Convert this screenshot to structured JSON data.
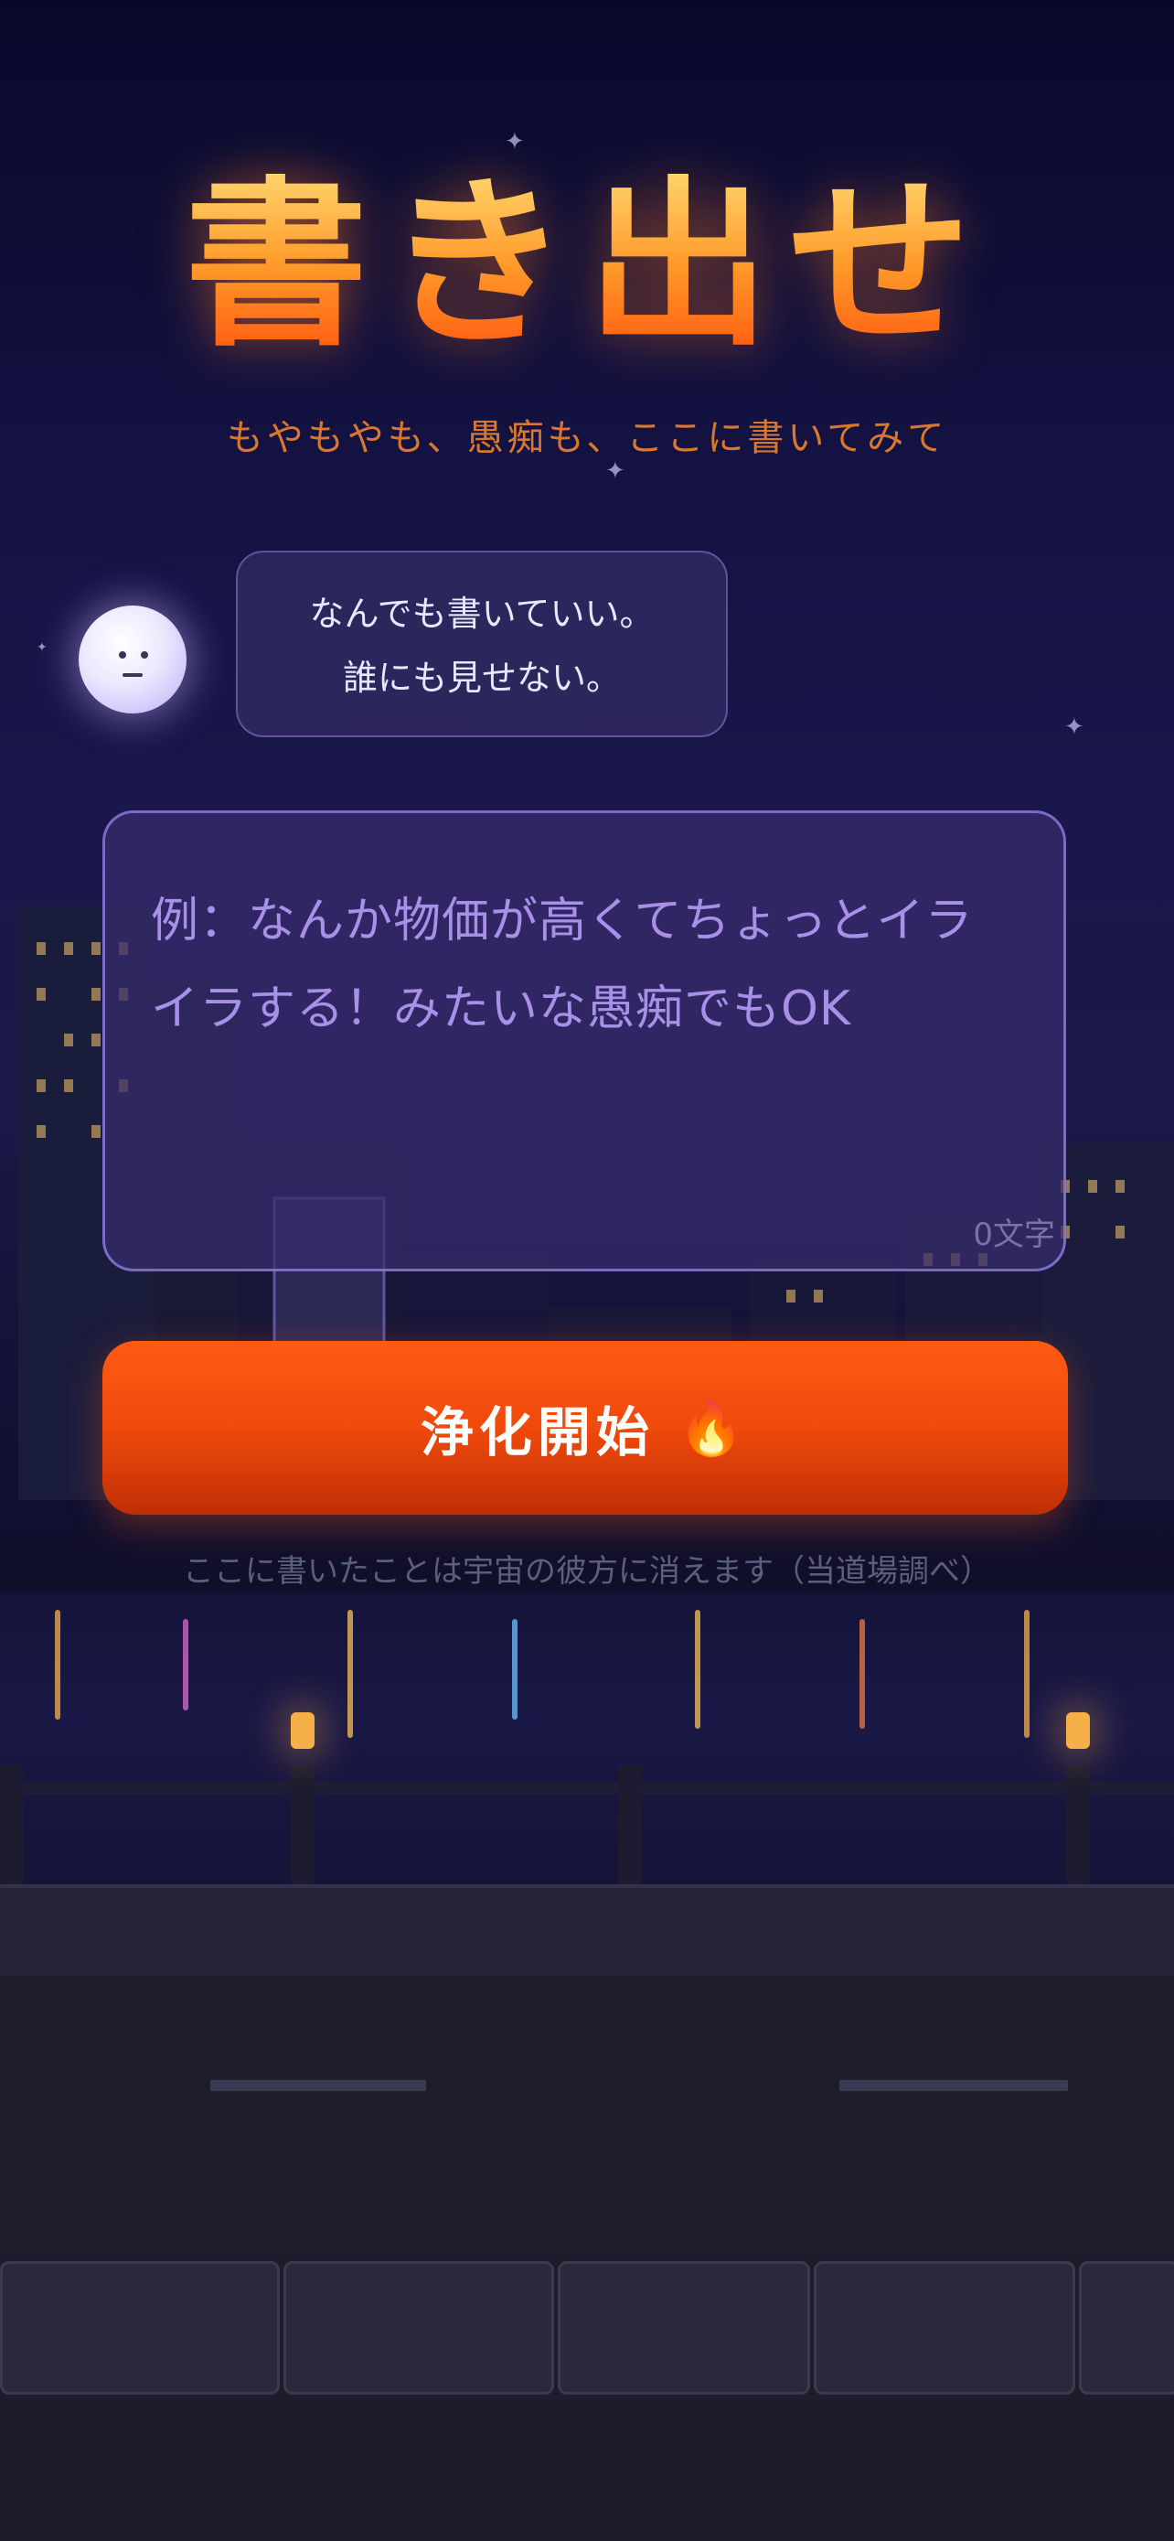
{
  "header": {
    "title": "書き出せ",
    "subtitle": "もやもやも、愚痴も、ここに書いてみて"
  },
  "bubble": {
    "line1": "なんでも書いていい。",
    "line2": "誰にも見せない。"
  },
  "input": {
    "placeholder": "例：なんか物価が高くてちょっとイライラする！みたいな愚痴でもOK",
    "value": "",
    "counter": "0文字"
  },
  "cta": {
    "label": "浄化開始",
    "icon": "fire-icon"
  },
  "note": "ここに書いたことは宇宙の彼方に消えます（当道場調べ）",
  "colors": {
    "accent": "#F04A0C",
    "title_top": "#FFD36B",
    "title_bottom": "#FF5A10",
    "placeholder": "#A890E8"
  }
}
